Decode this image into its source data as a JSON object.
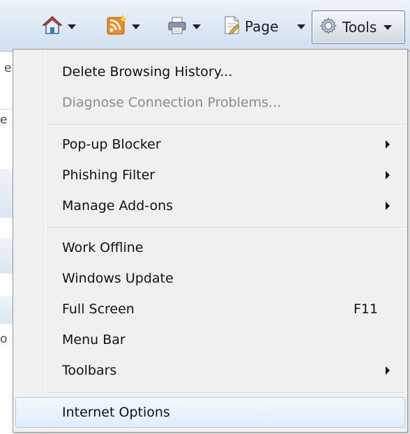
{
  "toolbar": {
    "home_icon": "home-icon",
    "feeds_icon": "rss-feeds-icon",
    "print_icon": "printer-icon",
    "page_label": "Page",
    "tools_label": "Tools",
    "bg_fragments": [
      "e",
      "e",
      "o"
    ]
  },
  "menu": {
    "items": [
      {
        "label": "Delete Browsing History...",
        "disabled": false
      },
      {
        "label": "Diagnose Connection Problems...",
        "disabled": true
      },
      {
        "label": "Pop-up Blocker",
        "submenu": true
      },
      {
        "label": "Phishing Filter",
        "submenu": true
      },
      {
        "label": "Manage Add-ons",
        "submenu": true
      },
      {
        "label": "Work Offline"
      },
      {
        "label": "Windows Update"
      },
      {
        "label": "Full Screen",
        "shortcut": "F11"
      },
      {
        "label": "Menu Bar"
      },
      {
        "label": "Toolbars",
        "submenu": true
      },
      {
        "label": "Internet Options",
        "highlighted": true
      }
    ]
  },
  "colors": {
    "menu_background": "#f0f0f0",
    "highlight_border": "#aecde9",
    "disabled_text": "#8a8a8a"
  }
}
